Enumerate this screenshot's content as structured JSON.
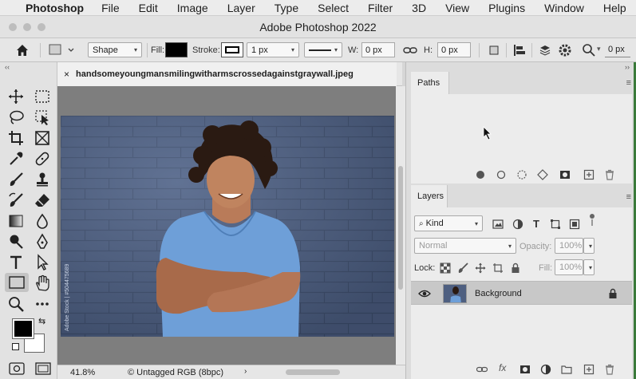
{
  "menubar": {
    "app": "Photoshop",
    "items": [
      "File",
      "Edit",
      "Image",
      "Layer",
      "Type",
      "Select",
      "Filter",
      "3D",
      "View",
      "Plugins",
      "Window",
      "Help"
    ]
  },
  "window": {
    "title": "Adobe Photoshop 2022"
  },
  "options_bar": {
    "mode_value": "Shape",
    "fill_label": "Fill:",
    "fill_color": "#000000",
    "stroke_label": "Stroke:",
    "stroke_width": "1 px",
    "w_label": "W:",
    "w_value": "0 px",
    "h_label": "H:",
    "h_value": "0 px",
    "corner_value": "0 px"
  },
  "document": {
    "filename": "handsomeyoungmansmilingwitharmscrossedagainstgraywall.jpeg",
    "zoom": "41.8%",
    "profile": "© Untagged RGB (8bpc)",
    "watermark": "Adobe Stock | #504475689"
  },
  "colors": {
    "foreground": "#000000",
    "background": "#ffffff",
    "accent_green": "#3a7a3a"
  },
  "paths_panel": {
    "tab": "Paths"
  },
  "layers_panel": {
    "tab": "Layers",
    "filter_kind": "Kind",
    "blend_mode": "Normal",
    "opacity_label": "Opacity:",
    "opacity_value": "100%",
    "lock_label": "Lock:",
    "fill_label": "Fill:",
    "fill_value": "100%",
    "layers": [
      {
        "name": "Background",
        "visible": true,
        "locked": true
      }
    ]
  }
}
